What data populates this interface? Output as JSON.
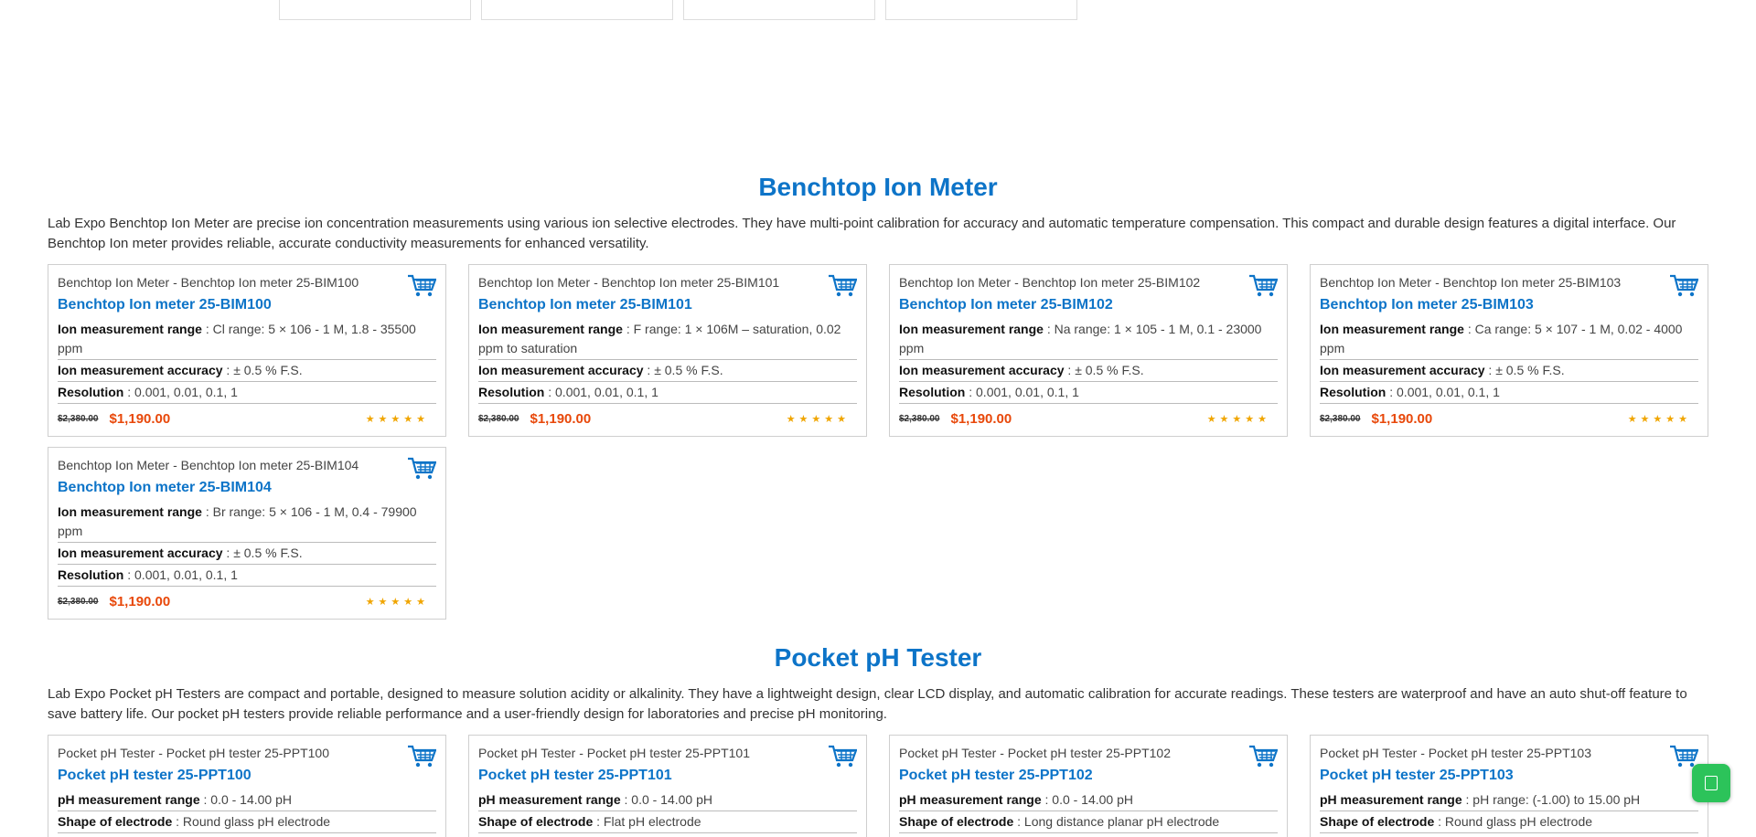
{
  "sections": [
    {
      "title": "Benchtop Ion Meter",
      "description": "Lab Expo Benchtop Ion Meter are precise ion concentration measurements using various ion selective electrodes. They have multi-point calibration for accuracy and automatic temperature compensation. This compact and durable design features a digital interface. Our Benchtop Ion meter provides reliable, accurate conductivity measurements for enhanced versatility.",
      "products": [
        {
          "image_alt": "Benchtop Ion Meter - Benchtop Ion meter 25-BIM100",
          "name": "Benchtop Ion meter 25-BIM100",
          "specs": [
            {
              "label": "Ion measurement range",
              "value": " : Cl range: 5 × 106 - 1 M, 1.8 - 35500 ppm"
            },
            {
              "label": "Ion measurement accuracy",
              "value": " : ± 0.5 % F.S."
            },
            {
              "label": "Resolution",
              "value": " : 0.001, 0.01, 0.1, 1"
            }
          ],
          "old_price": "$2,380.00",
          "price": "$1,190.00",
          "rating": "★★★★★"
        },
        {
          "image_alt": "Benchtop Ion Meter - Benchtop Ion meter 25-BIM101",
          "name": "Benchtop Ion meter 25-BIM101",
          "specs": [
            {
              "label": "Ion measurement range",
              "value": " : F range: 1 × 106M – saturation, 0.02 ppm to saturation"
            },
            {
              "label": "Ion measurement accuracy",
              "value": " : ± 0.5 % F.S."
            },
            {
              "label": "Resolution",
              "value": " : 0.001, 0.01, 0.1, 1"
            }
          ],
          "old_price": "$2,380.00",
          "price": "$1,190.00",
          "rating": "★★★★★"
        },
        {
          "image_alt": "Benchtop Ion Meter - Benchtop Ion meter 25-BIM102",
          "name": "Benchtop Ion meter 25-BIM102",
          "specs": [
            {
              "label": "Ion measurement range",
              "value": " : Na range: 1 × 105 - 1 M, 0.1 - 23000 ppm"
            },
            {
              "label": "Ion measurement accuracy",
              "value": " : ± 0.5 % F.S."
            },
            {
              "label": "Resolution",
              "value": " : 0.001, 0.01, 0.1, 1"
            }
          ],
          "old_price": "$2,380.00",
          "price": "$1,190.00",
          "rating": "★★★★★"
        },
        {
          "image_alt": "Benchtop Ion Meter - Benchtop Ion meter 25-BIM103",
          "name": "Benchtop Ion meter 25-BIM103",
          "specs": [
            {
              "label": "Ion measurement range",
              "value": " : Ca range: 5 × 107 - 1 M, 0.02 - 4000 ppm"
            },
            {
              "label": "Ion measurement accuracy",
              "value": " : ± 0.5 % F.S."
            },
            {
              "label": "Resolution",
              "value": " : 0.001, 0.01, 0.1, 1"
            }
          ],
          "old_price": "$2,380.00",
          "price": "$1,190.00",
          "rating": "★★★★★"
        },
        {
          "image_alt": "Benchtop Ion Meter - Benchtop Ion meter 25-BIM104",
          "name": "Benchtop Ion meter 25-BIM104",
          "specs": [
            {
              "label": "Ion measurement range",
              "value": " : Br range: 5 × 106 - 1 M, 0.4 - 79900 ppm"
            },
            {
              "label": "Ion measurement accuracy",
              "value": " : ± 0.5 % F.S."
            },
            {
              "label": "Resolution",
              "value": " : 0.001, 0.01, 0.1, 1"
            }
          ],
          "old_price": "$2,380.00",
          "price": "$1,190.00",
          "rating": "★★★★★"
        }
      ]
    },
    {
      "title": "Pocket pH Tester",
      "description": "Lab Expo Pocket pH Testers are compact and portable, designed to measure solution acidity or alkalinity. They have a lightweight design, clear LCD display, and automatic calibration for accurate readings. These testers are waterproof and have an auto shut-off feature to save battery life. Our pocket pH testers provide reliable performance and a user-friendly design for laboratories and precise pH monitoring.",
      "products": [
        {
          "image_alt": "Pocket pH Tester - Pocket pH tester 25-PPT100",
          "name": "Pocket pH tester 25-PPT100",
          "specs": [
            {
              "label": "pH measurement range",
              "value": " : 0.0 - 14.00 pH"
            },
            {
              "label": "Shape of electrode",
              "value": " : Round glass pH electrode"
            }
          ]
        },
        {
          "image_alt": "Pocket pH Tester - Pocket pH tester 25-PPT101",
          "name": "Pocket pH tester 25-PPT101",
          "specs": [
            {
              "label": "pH measurement range",
              "value": " : 0.0 - 14.00 pH"
            },
            {
              "label": "Shape of electrode",
              "value": " : Flat pH electrode"
            }
          ]
        },
        {
          "image_alt": "Pocket pH Tester - Pocket pH tester 25-PPT102",
          "name": "Pocket pH tester 25-PPT102",
          "specs": [
            {
              "label": "pH measurement range",
              "value": " : 0.0 - 14.00 pH"
            },
            {
              "label": "Shape of electrode",
              "value": " : Long distance planar pH electrode"
            }
          ]
        },
        {
          "image_alt": "Pocket pH Tester - Pocket pH tester 25-PPT103",
          "name": "Pocket pH tester 25-PPT103",
          "specs": [
            {
              "label": "pH measurement range",
              "value": " : pH range: (-1.00) to 15.00 pH"
            },
            {
              "label": "Shape of electrode",
              "value": " : Round glass pH electrode"
            }
          ]
        }
      ]
    }
  ],
  "colors": {
    "heading": "#0d74c8",
    "price": "#e8480a",
    "stars": "#f0a500",
    "cart": "#0d74c8",
    "chat": "#2cc35a"
  },
  "icons": {
    "cart": "shopping-cart-icon",
    "chat": "chat-icon"
  }
}
